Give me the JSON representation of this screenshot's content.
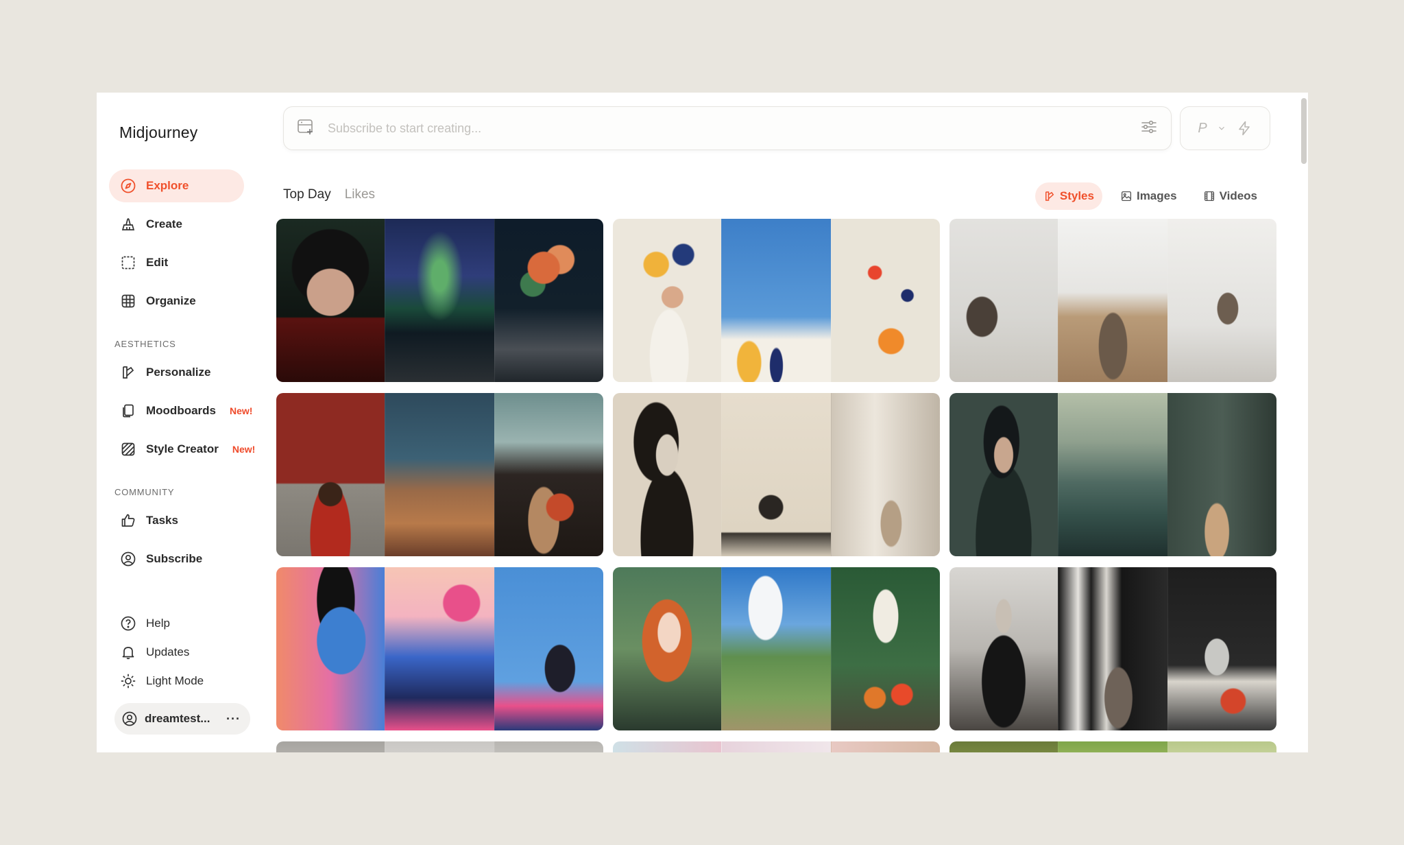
{
  "brand": "Midjourney",
  "nav": {
    "explore": "Explore",
    "create": "Create",
    "edit": "Edit",
    "organize": "Organize",
    "aesthetics_label": "AESTHETICS",
    "personalize": "Personalize",
    "moodboards": "Moodboards",
    "style_creator": "Style Creator",
    "new_badge": "New!",
    "community_label": "COMMUNITY",
    "tasks": "Tasks",
    "subscribe": "Subscribe",
    "help": "Help",
    "updates": "Updates",
    "light_mode": "Light Mode",
    "user": "dreamtest...",
    "more": "···"
  },
  "prompt": {
    "placeholder": "Subscribe to start creating..."
  },
  "mode": {
    "label": "P"
  },
  "tabs": {
    "top_day": "Top Day",
    "likes": "Likes"
  },
  "filters": {
    "styles": "Styles",
    "images": "Images",
    "videos": "Videos"
  },
  "colors": {
    "accent": "#f0502b",
    "accent_bg": "#fde9e4"
  }
}
